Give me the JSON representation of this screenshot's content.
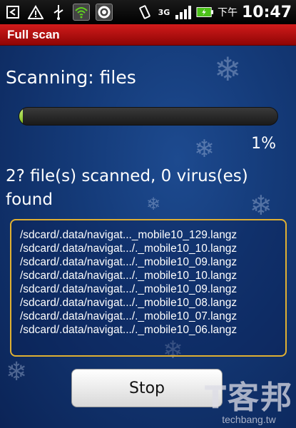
{
  "status_bar": {
    "icons": [
      "back-icon",
      "warning-icon",
      "usb-icon",
      "wifi-icon",
      "sync-icon",
      "vibrate-icon",
      "3g-icon",
      "signal-icon",
      "battery-icon"
    ],
    "net_label": "3G",
    "clock_prefix": "下午",
    "time": "10:47"
  },
  "title_bar": {
    "title": "Full scan"
  },
  "scan": {
    "status": "Scanning: files",
    "progress_percent": 1,
    "percent_label": "1%",
    "summary": "2? file(s) scanned, 0 virus(es) found",
    "files": [
      "/sdcard/.data/navigat..._mobile10_129.langz",
      "/sdcard/.data/navigat.../._mobile10_10.langz",
      "/sdcard/.data/navigat.../._mobile10_09.langz",
      "/sdcard/.data/navigat.../._mobile10_10.langz",
      "/sdcard/.data/navigat.../._mobile10_09.langz",
      "/sdcard/.data/navigat.../._mobile10_08.langz",
      "/sdcard/.data/navigat.../._mobile10_07.langz",
      "/sdcard/.data/navigat.../._mobile10_06.langz"
    ],
    "stop_label": "Stop"
  },
  "watermark": {
    "logo": "T客邦",
    "site": "techbang.tw"
  },
  "colors": {
    "title_bar": "#c01010",
    "background": "#143a78",
    "progress_fill": "#9ad43a",
    "list_border": "#e0b032"
  }
}
